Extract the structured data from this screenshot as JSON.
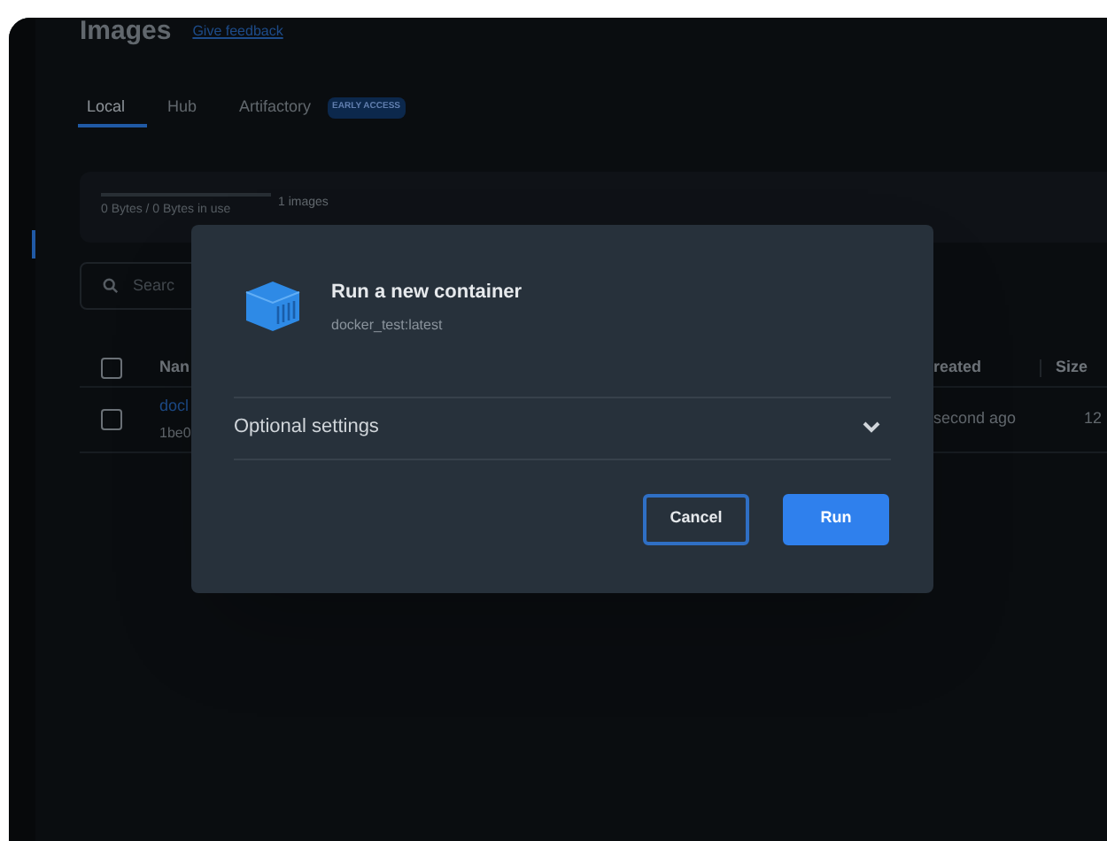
{
  "page": {
    "title": "Images",
    "feedback_link": "Give feedback"
  },
  "tabs": [
    {
      "label": "Local",
      "selected": true
    },
    {
      "label": "Hub",
      "selected": false
    },
    {
      "label": "Artifactory",
      "selected": false,
      "badge": "EARLY ACCESS"
    }
  ],
  "usage": {
    "text": "0 Bytes / 0 Bytes in use",
    "count": "1 images"
  },
  "search": {
    "placeholder": "Searc"
  },
  "table": {
    "header_checked": false,
    "columns": [
      "Nan",
      "reated",
      "Size"
    ],
    "rows": [
      {
        "name": "docl",
        "id": "1be0",
        "created": "second ago",
        "size": "12",
        "checked": false
      }
    ]
  },
  "dialog": {
    "title": "Run a new container",
    "subtitle": "docker_test:latest",
    "section": {
      "label": "Optional settings",
      "expanded": false
    },
    "buttons": [
      {
        "label": "Cancel",
        "kind": "secondary"
      },
      {
        "label": "Run",
        "kind": "primary"
      }
    ]
  }
}
